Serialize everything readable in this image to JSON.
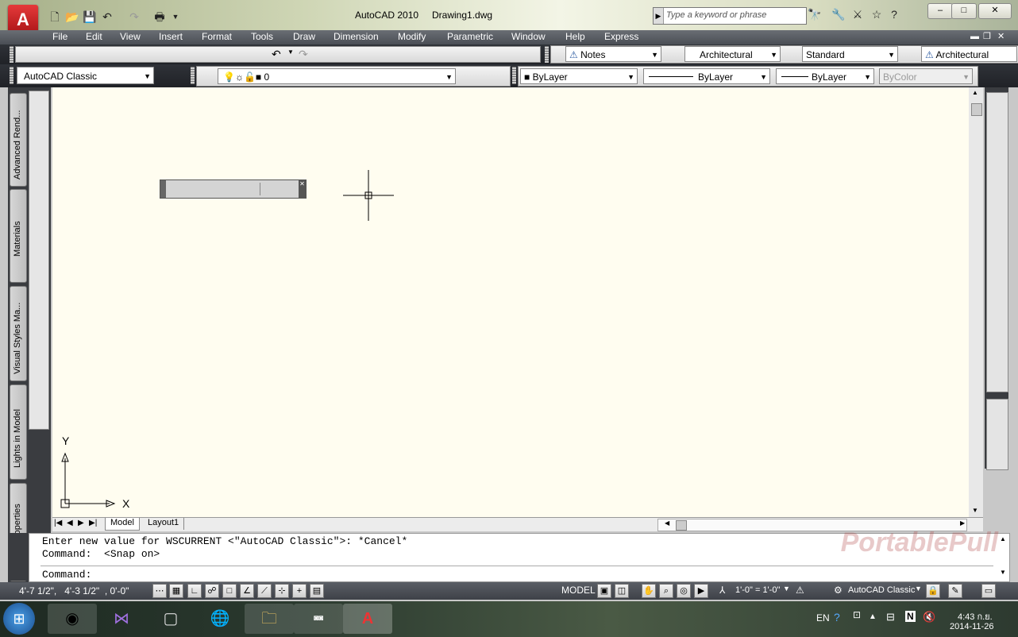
{
  "title_bar": {
    "app_title": "AutoCAD 2010",
    "document": "Drawing1.dwg",
    "app_logo": "A",
    "search_placeholder": "Type a keyword or phrase",
    "window_controls": [
      "–",
      "□",
      "✕"
    ]
  },
  "menu": {
    "items": [
      "File",
      "Edit",
      "View",
      "Insert",
      "Format",
      "Tools",
      "Draw",
      "Dimension",
      "Modify",
      "Parametric",
      "Window",
      "Help",
      "Express"
    ]
  },
  "toolbar1": {
    "text_style": "Notes",
    "dim_style": "Architectural",
    "table_style": "Standard",
    "mleader_style": "Architectural"
  },
  "toolbar2": {
    "workspace": "AutoCAD Classic",
    "layer": "0",
    "color": "ByLayer",
    "linetype": "ByLayer",
    "lineweight": "ByLayer",
    "plotstyle": "ByColor"
  },
  "palette_tabs": [
    "Advanced Rend...",
    "Materials",
    "Visual Styles Ma...",
    "Lights in Model",
    "Sun Properties"
  ],
  "drawing": {
    "ucs_x": "X",
    "ucs_y": "Y"
  },
  "layout_tabs": [
    "Model",
    "Layout1"
  ],
  "command": {
    "line1": "Enter new value for WSCURRENT <\"AutoCAD Classic\">: *Cancel*",
    "line2": "Command:  <Snap on>",
    "prompt": "Command:"
  },
  "status": {
    "coords": "4'-7 1/2\",   4'-3 1/2\"  , 0'-0\"",
    "model": "MODEL",
    "scale": "1'-0\" = 1'-0\"",
    "workspace": "AutoCAD Classic"
  },
  "taskbar": {
    "lang": "EN",
    "time": "4:43 ก.ย.",
    "date": "2014-11-26"
  },
  "watermark": "PortablePull"
}
